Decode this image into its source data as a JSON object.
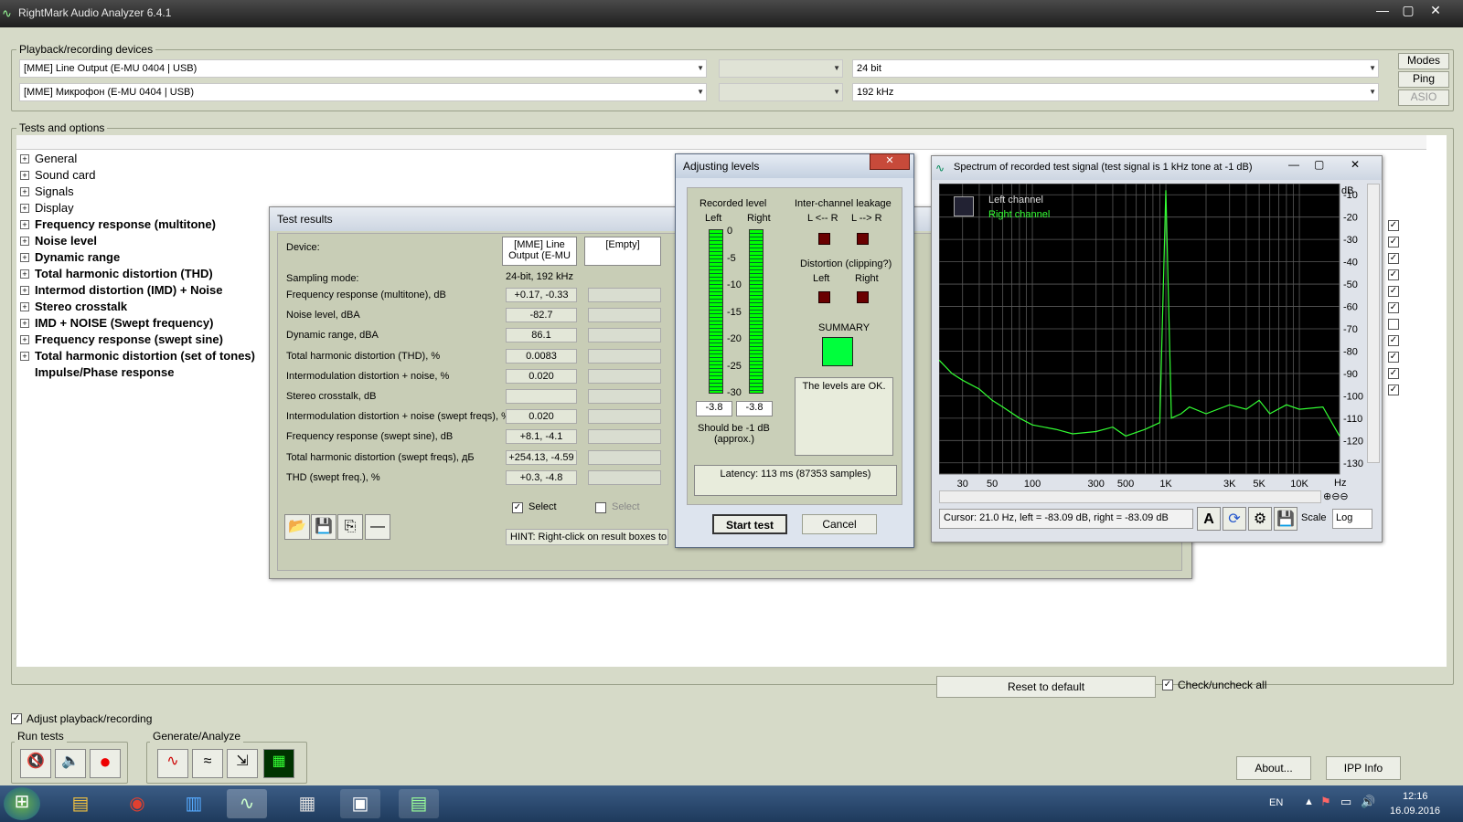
{
  "window": {
    "title": "RightMark Audio Analyzer 6.4.1",
    "min": "—",
    "max": "▢",
    "close": "✕"
  },
  "devices": {
    "label": "Playback/recording devices",
    "playback": "[MME] Line Output (E-MU 0404 | USB)",
    "recording": "[MME] Микрофон (E-MU 0404 | USB)",
    "bits": "24 bit",
    "rate": "192 kHz",
    "modes": "Modes",
    "ping": "Ping",
    "asio": "ASIO"
  },
  "tests": {
    "label": "Tests and options",
    "items": [
      {
        "label": "General",
        "bold": false
      },
      {
        "label": "Sound card",
        "bold": false
      },
      {
        "label": "Signals",
        "bold": false
      },
      {
        "label": "Display",
        "bold": false
      },
      {
        "label": "Frequency response (multitone)",
        "bold": true
      },
      {
        "label": "Noise level",
        "bold": true
      },
      {
        "label": "Dynamic range",
        "bold": true
      },
      {
        "label": "Total harmonic distortion (THD)",
        "bold": true
      },
      {
        "label": "Intermod distortion (IMD) + Noise",
        "bold": true
      },
      {
        "label": "Stereo crosstalk",
        "bold": true
      },
      {
        "label": "IMD + NOISE (Swept frequency)",
        "bold": true
      },
      {
        "label": "Frequency response (swept sine)",
        "bold": true
      },
      {
        "label": "Total harmonic distortion (set of tones)",
        "bold": true
      },
      {
        "label": "Impulse/Phase response",
        "bold": true
      }
    ],
    "checks": [
      true,
      true,
      true,
      true,
      true,
      true,
      false,
      true,
      true,
      true,
      true
    ],
    "reset": "Reset to default",
    "check_all": "Check/uncheck all"
  },
  "results": {
    "title": "Test results",
    "device_label": "Device:",
    "device_val": "[MME] Line Output (E-MU",
    "empty": "[Empty]",
    "sampling_label": "Sampling mode:",
    "sampling_val": "24-bit, 192 kHz",
    "rows": [
      {
        "label": "Frequency response (multitone), dB",
        "value": "+0.17, -0.33"
      },
      {
        "label": "Noise level, dBA",
        "value": "-82.7"
      },
      {
        "label": "Dynamic range, dBA",
        "value": "86.1"
      },
      {
        "label": "Total harmonic distortion (THD), %",
        "value": "0.0083"
      },
      {
        "label": "Intermodulation distortion + noise, %",
        "value": "0.020"
      },
      {
        "label": "Stereo crosstalk, dB",
        "value": ""
      },
      {
        "label": "Intermodulation distortion + noise (swept freqs), %",
        "value": "0.020"
      },
      {
        "label": "Frequency response (swept sine), dB",
        "value": "+8.1, -4.1"
      },
      {
        "label": "Total harmonic distortion (swept freqs), дБ",
        "value": "+254.13, -4.59"
      },
      {
        "label": "THD (swept freq.), %",
        "value": "+0.3, -4.8"
      }
    ],
    "select": "Select",
    "select2": "Select",
    "hint": "HINT: Right-click on result boxes to vi"
  },
  "levels": {
    "title": "Adjusting levels",
    "recorded": "Recorded level",
    "left": "Left",
    "right": "Right",
    "scale": [
      "0",
      "-5",
      "-10",
      "-15",
      "-20",
      "-25",
      "-30"
    ],
    "left_val": "-3.8",
    "right_val": "-3.8",
    "should": "Should be  -1 dB",
    "approx": "(approx.)",
    "leak": "Inter-channel leakage",
    "lr": "L <-- R",
    "rl": "L --> R",
    "dist": "Distortion (clipping?)",
    "dleft": "Left",
    "dright": "Right",
    "summary": "SUMMARY",
    "ok": "The levels are OK.",
    "latency": "Latency: 113 ms (87353 samples)",
    "start": "Start test",
    "cancel": "Cancel",
    "summary_color": "#00ff3c"
  },
  "spectrum": {
    "title": "Spectrum of recorded test signal (test signal is 1 kHz tone at -1 dB)",
    "left_ch": "Left channel",
    "right_ch": "Right channel",
    "db_unit": "dB",
    "hz_unit": "Hz",
    "cursor": "Cursor:  21.0 Hz,  left = -83.09 dB,  right = -83.09 dB",
    "scale_label": "Scale",
    "scale_val": "Log"
  },
  "chart_data": {
    "type": "line",
    "xscale": "log",
    "xlim": [
      20,
      20000
    ],
    "ylim": [
      -135,
      -5
    ],
    "xticks": [
      "30",
      "50",
      "100",
      "300",
      "500",
      "1K",
      "3K",
      "5K",
      "10K"
    ],
    "yticks": [
      "-10",
      "-20",
      "-30",
      "-40",
      "-50",
      "-60",
      "-70",
      "-80",
      "-90",
      "-100",
      "-110",
      "-120",
      "-130"
    ],
    "series": [
      {
        "name": "Right channel",
        "color": "#33ff33",
        "x": [
          20,
          25,
          30,
          40,
          50,
          60,
          80,
          100,
          150,
          200,
          300,
          400,
          500,
          700,
          900,
          1000,
          1100,
          1300,
          1500,
          2000,
          3000,
          4000,
          5000,
          6000,
          8000,
          10000,
          15000,
          20000
        ],
        "y": [
          -84,
          -90,
          -93,
          -97,
          -102,
          -105,
          -110,
          -113,
          -115,
          -117,
          -116,
          -114,
          -118,
          -115,
          -112,
          -8,
          -110,
          -108,
          -105,
          -108,
          -104,
          -106,
          -102,
          -108,
          -104,
          -106,
          -105,
          -118
        ]
      }
    ]
  },
  "bottom": {
    "adjust": "Adjust playback/recording",
    "run": "Run tests",
    "gen": "Generate/Analyze",
    "about": "About...",
    "ipp": "IPP Info"
  },
  "taskbar": {
    "lang": "EN",
    "time": "12:16",
    "date": "16.09.2016"
  }
}
